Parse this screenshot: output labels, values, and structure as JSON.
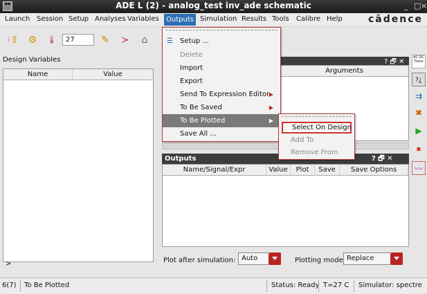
{
  "window": {
    "title": "ADE L (2) - analog_test inv_ade schematic",
    "minimize": "_",
    "close": "×"
  },
  "menubar": {
    "items": [
      "Launch",
      "Session",
      "Setup",
      "Analyses",
      "Variables",
      "Outputs",
      "Simulation",
      "Results",
      "Tools",
      "Calibre",
      "Help"
    ],
    "active": "Outputs",
    "logo": "cādence"
  },
  "toolbar": {
    "temperature": "27"
  },
  "design_variables": {
    "header": "Design Variables",
    "col_name": "Name",
    "col_value": "Value",
    "expander": ">"
  },
  "analyses": {
    "col_arguments": "Arguments"
  },
  "outputs": {
    "header": "Outputs",
    "panel_buttons": "? 🗗 ✕",
    "columns": [
      "Name/Signal/Expr",
      "Value",
      "Plot",
      "Save",
      "Save Options"
    ],
    "scroll_mark": "III"
  },
  "plot_settings": {
    "after_label": "Plot after simulation:",
    "after_value": "Auto",
    "mode_label": "Plotting mode:",
    "mode_value": "Replace"
  },
  "outputs_menu": {
    "items": [
      {
        "label": "Setup ...",
        "disabled": false,
        "submenu": false
      },
      {
        "label": "Delete",
        "disabled": true,
        "submenu": false
      },
      {
        "label": "Import",
        "disabled": false,
        "submenu": false
      },
      {
        "label": "Export",
        "disabled": false,
        "submenu": false
      },
      {
        "label": "Send To Expression Editor",
        "disabled": false,
        "submenu": true
      },
      {
        "label": "To Be Saved",
        "disabled": false,
        "submenu": true
      },
      {
        "label": "To Be Plotted",
        "disabled": false,
        "submenu": true,
        "highlighted": true
      },
      {
        "label": "Save All ...",
        "disabled": false,
        "submenu": false
      }
    ]
  },
  "plotted_submenu": {
    "items": [
      {
        "label": "Select On Design",
        "disabled": false,
        "selected": true
      },
      {
        "label": "Add To",
        "disabled": true
      },
      {
        "label": "Remove From",
        "disabled": true
      }
    ]
  },
  "right_icons": {
    "ac_dc_trans": "AC DC Trans"
  },
  "statusbar": {
    "index": "6(7)",
    "message": "To Be Plotted",
    "status": "Status: Ready",
    "temp": "T=27  C",
    "simulator": "Simulator: spectre"
  },
  "colors": {
    "title_bg": "#1c1c1c",
    "menu_active": "#2c6fb3",
    "accent_red": "#b22222",
    "highlight_gray": "#7a7a7a"
  }
}
